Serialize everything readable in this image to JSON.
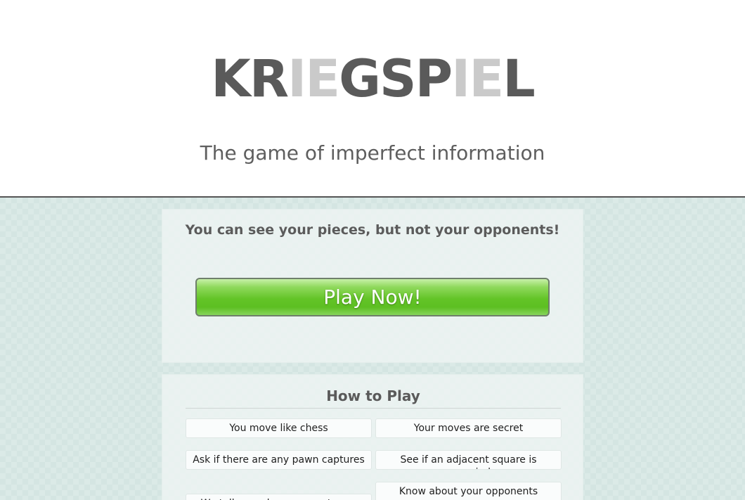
{
  "header": {
    "logo_letters": [
      {
        "char": "K",
        "tone": "dark"
      },
      {
        "char": "R",
        "tone": "dark"
      },
      {
        "char": "I",
        "tone": "light"
      },
      {
        "char": "E",
        "tone": "light"
      },
      {
        "char": "G",
        "tone": "dark"
      },
      {
        "char": "S",
        "tone": "dark"
      },
      {
        "char": "P",
        "tone": "dark"
      },
      {
        "char": "I",
        "tone": "light"
      },
      {
        "char": "E",
        "tone": "light"
      },
      {
        "char": "L",
        "tone": "dark"
      }
    ],
    "tagline": "The game of imperfect information"
  },
  "intro": {
    "pitch": "You can see your pieces, but not your opponents!",
    "play_button": "Play Now!"
  },
  "how_to_play": {
    "title": "How to Play",
    "rules": [
      "You move like chess",
      "Your moves are secret",
      "Ask if there are any pawn captures",
      "See if an adjacent square is occupied",
      "We tell you when you capture a piece",
      "Know about your opponents captures"
    ]
  },
  "colors": {
    "logo_dark": "#5a5a5a",
    "logo_light": "#cacaca",
    "play_button_green": "#63c427",
    "background_checker": "#d4e5e2"
  }
}
